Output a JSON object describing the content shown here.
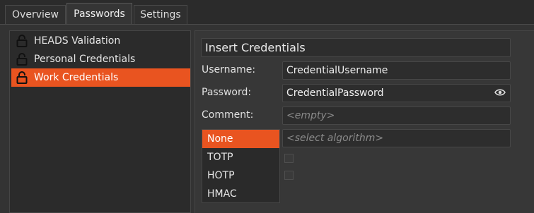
{
  "tabs": [
    {
      "label": "Overview",
      "active": false
    },
    {
      "label": "Passwords",
      "active": true
    },
    {
      "label": "Settings",
      "active": false
    }
  ],
  "credentials_list": [
    {
      "label": "HEADS Validation",
      "icon": "lock-icon",
      "selected": false
    },
    {
      "label": "Personal Credentials",
      "icon": "lock-icon",
      "selected": false
    },
    {
      "label": "Work Credentials",
      "icon": "lock-icon",
      "selected": true
    }
  ],
  "form": {
    "title": "Insert Credentials",
    "username_label": "Username:",
    "username_value": "CredentialUsername",
    "password_label": "Password:",
    "password_value": "CredentialPassword",
    "password_icon": "eye-icon",
    "comment_label": "Comment:",
    "comment_placeholder": "<empty>",
    "algorithm_placeholder": "<select algorithm>"
  },
  "algorithms": [
    {
      "label": "None",
      "selected": true
    },
    {
      "label": "TOTP",
      "selected": false
    },
    {
      "label": "HOTP",
      "selected": false
    },
    {
      "label": "HMAC",
      "selected": false
    }
  ],
  "colors": {
    "accent": "#e95420",
    "background": "#313131"
  }
}
